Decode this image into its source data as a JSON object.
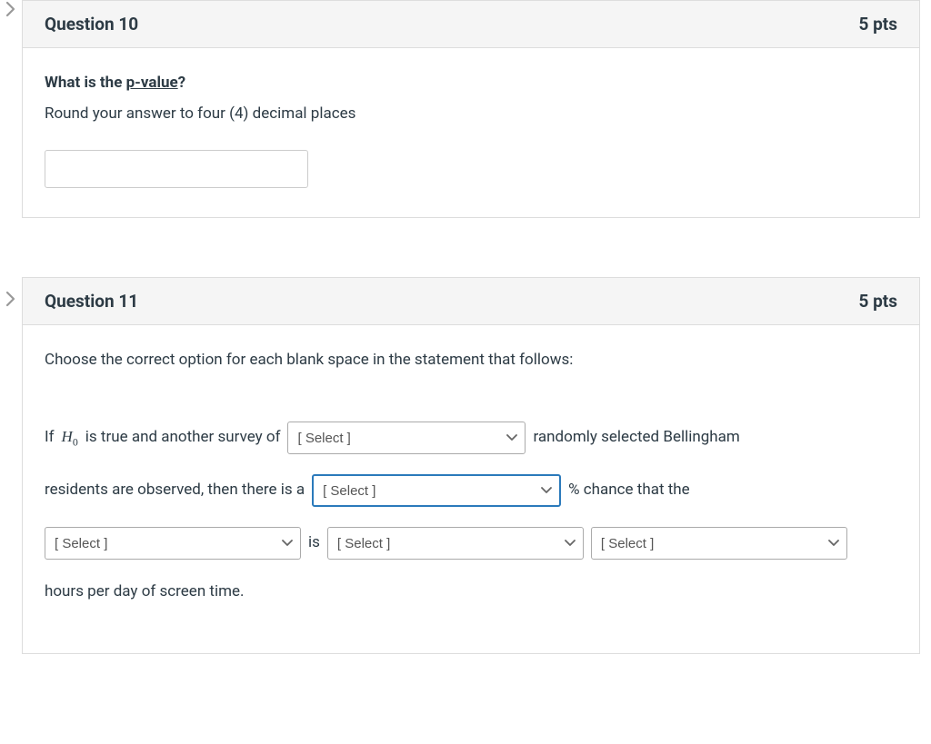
{
  "q10": {
    "header_title": "Question 10",
    "points": "5 pts",
    "prompt_prefix": "What is the ",
    "prompt_term": "p-value",
    "prompt_suffix": "?",
    "sub": "Round your answer to four (4) decimal places",
    "input_value": ""
  },
  "q11": {
    "header_title": "Question 11",
    "points": "5 pts",
    "intro": "Choose the correct option for each blank space in the statement that follows:",
    "row1_prefix": "If ",
    "row1_var_main": "H",
    "row1_var_sub": "0",
    "row1_mid": " is true and another survey of",
    "row1_after": "randomly selected Bellingham",
    "row2_prefix": "residents are observed, then there is a",
    "row2_after": "% chance that the",
    "row3_mid": "is",
    "row4": "hours per day of screen time.",
    "select_placeholder": "[ Select ]"
  }
}
